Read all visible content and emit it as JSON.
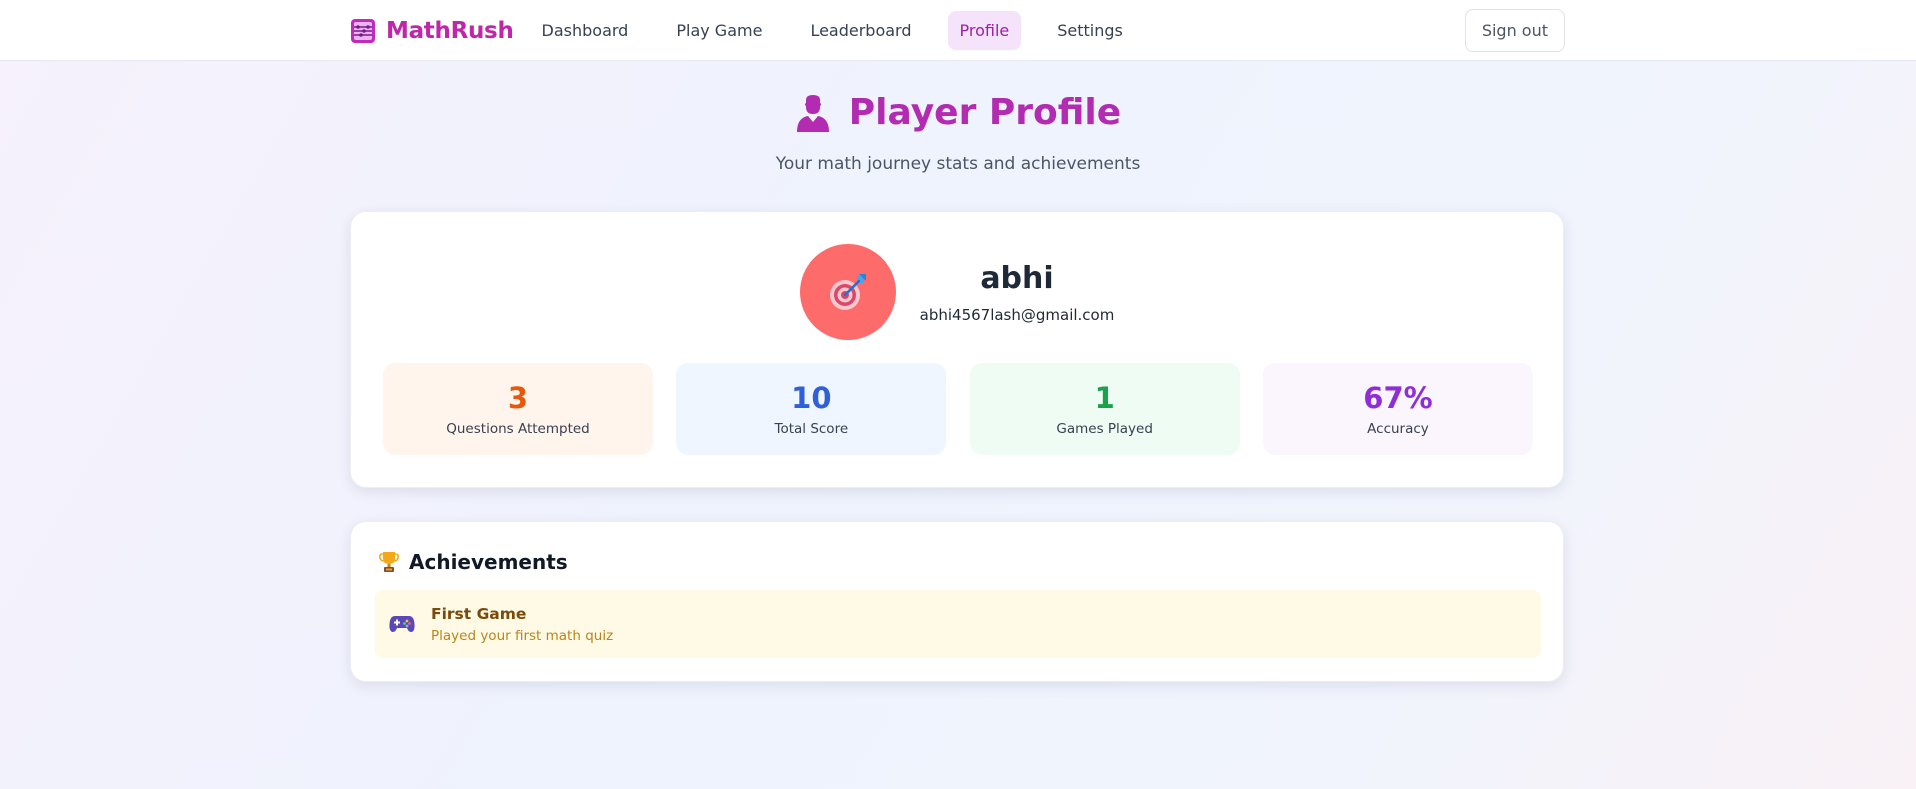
{
  "nav": {
    "brand": "MathRush",
    "links": [
      {
        "label": "Dashboard",
        "active": false
      },
      {
        "label": "Play Game",
        "active": false
      },
      {
        "label": "Leaderboard",
        "active": false
      },
      {
        "label": "Profile",
        "active": true
      },
      {
        "label": "Settings",
        "active": false
      }
    ],
    "signout_label": "Sign out",
    "brand_icon": "abacus-icon"
  },
  "header": {
    "title": "Player Profile",
    "subtitle": "Your math journey stats and achievements",
    "title_icon": "user-silhouette-icon"
  },
  "profile": {
    "avatar_icon": "target-icon",
    "username": "abhi",
    "email": "abhi4567lash@gmail.com",
    "stats": [
      {
        "value": "3",
        "label": "Questions Attempted",
        "color": "#e8580c"
      },
      {
        "value": "10",
        "label": "Total Score",
        "color": "#2f60d8"
      },
      {
        "value": "1",
        "label": "Games Played",
        "color": "#16a34a"
      },
      {
        "value": "67%",
        "label": "Accuracy",
        "color": "#8f2ed6"
      }
    ]
  },
  "achievements": {
    "title": "Achievements",
    "title_icon": "trophy-icon",
    "items": [
      {
        "icon": "gamepad-icon",
        "name": "First Game",
        "description": "Played your first math quiz"
      }
    ]
  },
  "colors": {
    "brand": "#c026a8",
    "avatar_bg": "#fe6b6b",
    "active_tab_bg": "#f5e2fb"
  }
}
